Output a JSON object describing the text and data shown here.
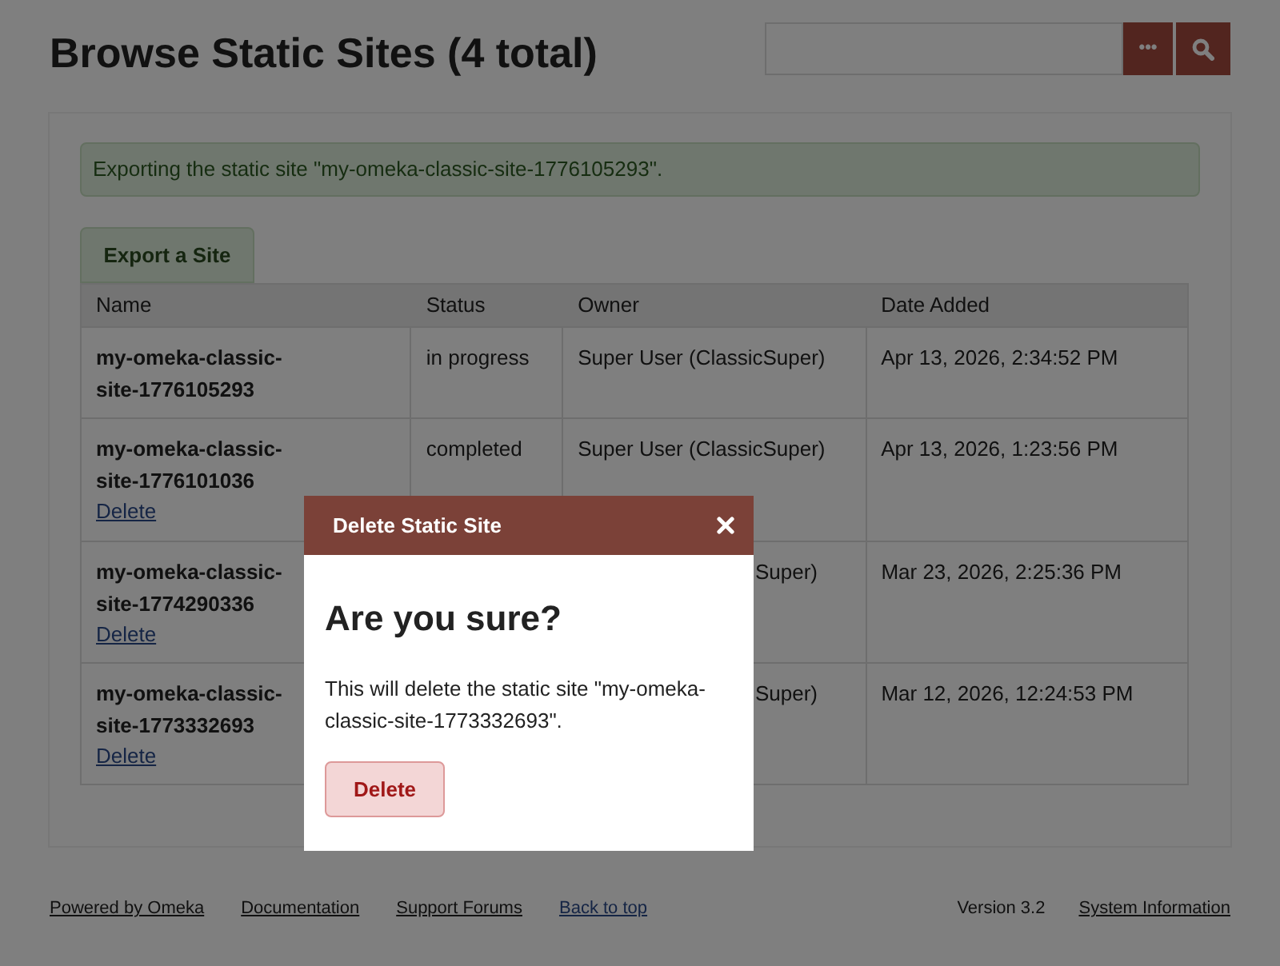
{
  "page": {
    "title": "Browse Static Sites (4 total)"
  },
  "search": {
    "advanced_button": "•••"
  },
  "flash": {
    "message": "Exporting the static site \"my-omeka-classic-site-1776105293\"."
  },
  "export_button": "Export a Site",
  "table": {
    "columns": [
      "Name",
      "Status",
      "Owner",
      "Date Added"
    ],
    "rows": [
      {
        "name": "my-omeka-classic-site-1776105293",
        "status": "in progress",
        "owner": "Super User (ClassicSuper)",
        "owner_covered": false,
        "date": "Apr 13, 2026, 2:34:52 PM"
      },
      {
        "name": "my-omeka-classic-site-1776101036",
        "status": "completed",
        "owner": "Super User (ClassicSuper)",
        "owner_covered": false,
        "date": "Apr 13, 2026, 1:23:56 PM",
        "action": "Delete"
      },
      {
        "name": "my-omeka-classic-site-1774290336",
        "owner": "Super)",
        "owner_covered": true,
        "date": "Mar 23, 2026, 2:25:36 PM",
        "action": "Delete"
      },
      {
        "name": "my-omeka-classic-site-1773332693",
        "owner": "Super)",
        "owner_covered": true,
        "date": "Mar 12, 2026, 12:24:53 PM",
        "action": "Delete"
      }
    ]
  },
  "footer": {
    "links": [
      "Powered by Omeka",
      "Documentation",
      "Support Forums"
    ],
    "back_to_top": "Back to top",
    "version": "Version 3.2",
    "system_info": "System Information"
  },
  "dialog": {
    "title": "Delete Static Site",
    "heading": "Are you sure?",
    "message": "This will delete the static site \"my-omeka-classic-site-1773332693\".",
    "button": "Delete"
  }
}
